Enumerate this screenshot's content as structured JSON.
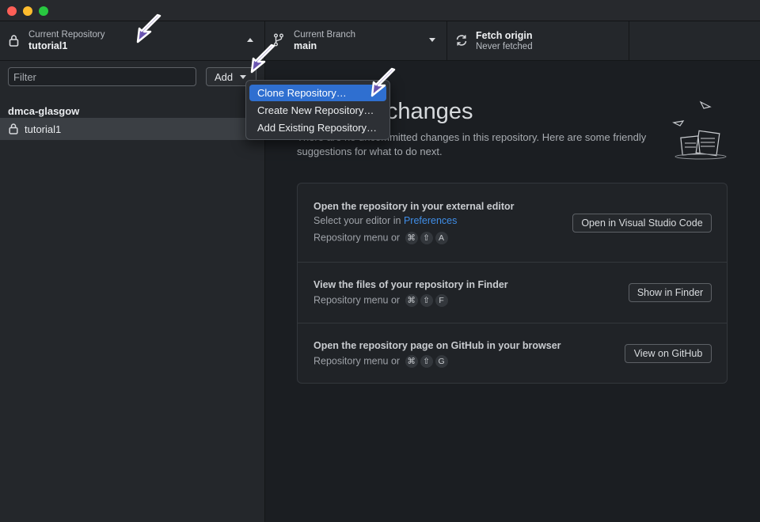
{
  "window": {
    "traffic_lights": {
      "close": "#fe5f57",
      "minimize": "#febc2e",
      "zoom": "#28c840"
    }
  },
  "toolbar": {
    "repository": {
      "label": "Current Repository",
      "value": "tutorial1",
      "icon": "lock-icon"
    },
    "branch": {
      "label": "Current Branch",
      "value": "main",
      "icon": "branch-icon"
    },
    "fetch": {
      "label": "Fetch origin",
      "value": "Never fetched",
      "icon": "sync-icon"
    }
  },
  "sidebar": {
    "filter_placeholder": "Filter",
    "add_label": "Add",
    "group_title": "dmca-glasgow",
    "repositories": [
      {
        "name": "tutorial1",
        "icon": "lock-icon",
        "selected": true
      }
    ]
  },
  "add_menu": {
    "items": [
      {
        "label": "Clone Repository…",
        "highlighted": true
      },
      {
        "label": "Create New Repository…",
        "highlighted": false
      },
      {
        "label": "Add Existing Repository…",
        "highlighted": false
      }
    ]
  },
  "main": {
    "heading": "No local changes",
    "description_line1": "There are no uncommitted changes in this repository. Here are some friendly",
    "description_line2": "suggestions for what to do next.",
    "suggestions": [
      {
        "title": "Open the repository in your external editor",
        "subtitle_prefix": "Select your editor in ",
        "subtitle_link": "Preferences",
        "shortcut_prefix": "Repository menu or",
        "shortcut_keys": [
          "⌘",
          "⇧",
          "A"
        ],
        "button": "Open in Visual Studio Code"
      },
      {
        "title": "View the files of your repository in Finder",
        "shortcut_prefix": "Repository menu or",
        "shortcut_keys": [
          "⌘",
          "⇧",
          "F"
        ],
        "button": "Show in Finder"
      },
      {
        "title": "Open the repository page on GitHub in your browser",
        "shortcut_prefix": "Repository menu or",
        "shortcut_keys": [
          "⌘",
          "⇧",
          "G"
        ],
        "button": "View on GitHub"
      }
    ]
  },
  "colors": {
    "accent": "#2f6fd0",
    "link": "#3f8ee8",
    "annotation_arrow": "#6a55b0"
  }
}
